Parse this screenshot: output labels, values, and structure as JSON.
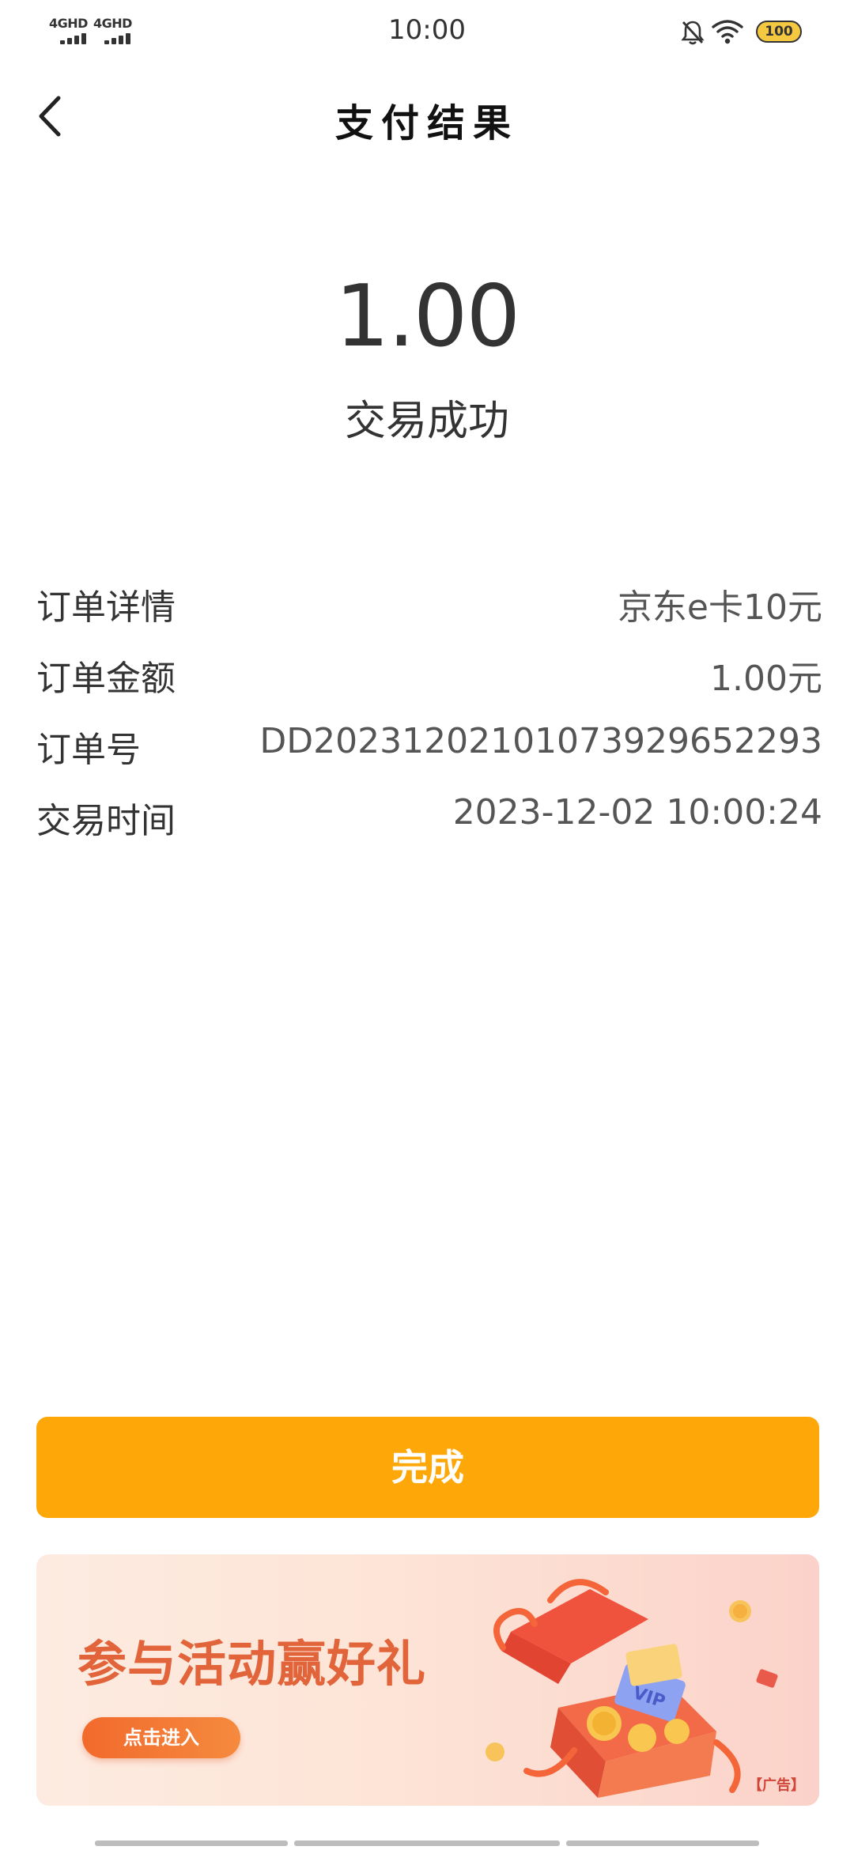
{
  "status_bar": {
    "time": "10:00",
    "signal_1_label": "4GHD",
    "signal_2_label": "4GHD",
    "battery": "100"
  },
  "header": {
    "title": "支付结果",
    "back_icon": "chevron-left-icon"
  },
  "result": {
    "amount": "1.00",
    "status": "交易成功"
  },
  "order": {
    "rows": [
      {
        "label": "订单详情",
        "value": "京东e卡10元"
      },
      {
        "label": "订单金额",
        "value": "1.00元"
      },
      {
        "label": "订单号",
        "value": "DD20231202101073929652293"
      },
      {
        "label": "交易时间",
        "value": "2023-12-02 10:00:24"
      }
    ]
  },
  "done_button": {
    "label": "完成"
  },
  "banner": {
    "title": "参与活动赢好礼",
    "button_label": "点击进入",
    "ad_tag": "【广告】"
  },
  "colors": {
    "accent": "#fda808",
    "banner_title": "#e2643a",
    "banner_button": "#f26a2c"
  }
}
